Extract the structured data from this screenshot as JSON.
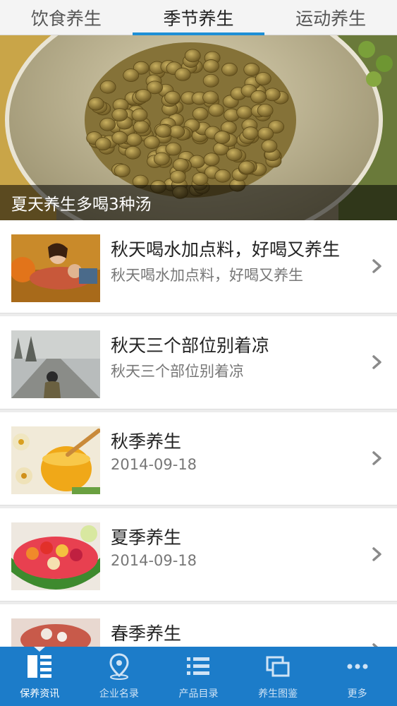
{
  "tabs": [
    {
      "label": "饮食养生"
    },
    {
      "label": "季节养生"
    },
    {
      "label": "运动养生"
    }
  ],
  "active_tab": 1,
  "banner": {
    "caption": "夏天养生多喝3种汤"
  },
  "list": [
    {
      "title": "秋天喝水加点料，好喝又养生",
      "subtitle": "秋天喝水加点料，好喝又养生"
    },
    {
      "title": "秋天三个部位别着凉",
      "subtitle": "秋天三个部位别着凉"
    },
    {
      "title": "秋季养生",
      "subtitle": "2014-09-18"
    },
    {
      "title": "夏季养生",
      "subtitle": "2014-09-18"
    },
    {
      "title": "春季养生",
      "subtitle": ""
    }
  ],
  "bottom_nav": [
    {
      "label": "保养资讯",
      "icon": "news-list-icon"
    },
    {
      "label": "企业名录",
      "icon": "location-pin-icon"
    },
    {
      "label": "产品目录",
      "icon": "catalog-list-icon"
    },
    {
      "label": "养生图鉴",
      "icon": "gallery-icon"
    },
    {
      "label": "更多",
      "icon": "more-dots-icon"
    }
  ],
  "colors": {
    "accent": "#1e8fd6",
    "nav_bg": "#1c7cc9"
  }
}
